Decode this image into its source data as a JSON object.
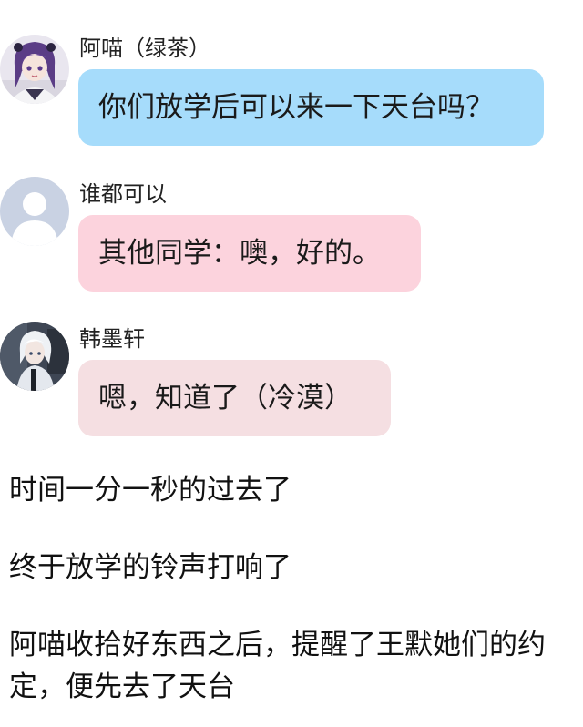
{
  "messages": [
    {
      "sender": "阿喵（绿茶）",
      "text": "你们放学后可以来一下天台吗？",
      "bubble_color": "#a6dcfb",
      "avatar": "anime-girl-purple-hair-avatar"
    },
    {
      "sender": "谁都可以",
      "text": "其他同学：噢，好的。",
      "bubble_color": "#fcd3dd",
      "avatar": "default-silhouette-avatar"
    },
    {
      "sender": "韩墨轩",
      "text": "嗯，知道了（冷漠）",
      "bubble_color": "#f5dfe2",
      "avatar": "anime-boy-white-hair-avatar"
    }
  ],
  "narration": [
    "时间一分一秒的过去了",
    "终于放学的铃声打响了",
    "阿喵收拾好东西之后，提醒了王默她们的约定，便先去了天台"
  ]
}
